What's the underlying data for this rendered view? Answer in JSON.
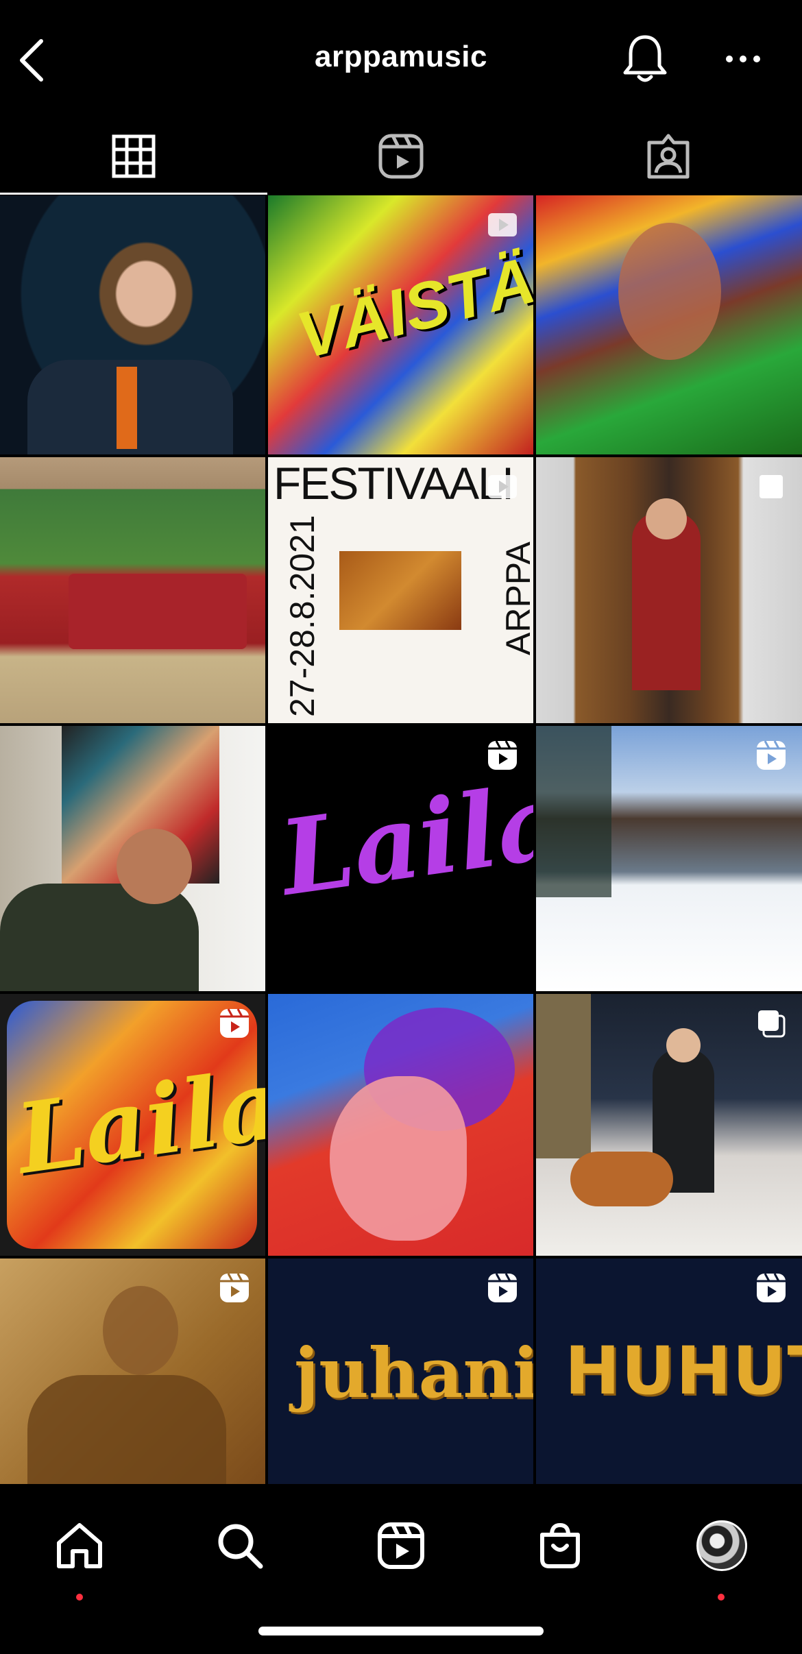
{
  "header": {
    "username": "arppamusic"
  },
  "tabs": [
    {
      "name": "posts",
      "icon": "grid-icon",
      "active": true
    },
    {
      "name": "reels",
      "icon": "reels-icon",
      "active": false
    },
    {
      "name": "tagged",
      "icon": "tagged-icon",
      "active": false
    }
  ],
  "grid": {
    "posts": [
      {
        "row": 1,
        "col": 1,
        "type": "photo",
        "badge": ""
      },
      {
        "row": 1,
        "col": 2,
        "type": "reel",
        "badge": "video-icon",
        "text": "VÄISTÄ"
      },
      {
        "row": 1,
        "col": 3,
        "type": "photo",
        "badge": ""
      },
      {
        "row": 2,
        "col": 1,
        "type": "photo",
        "badge": ""
      },
      {
        "row": 2,
        "col": 2,
        "type": "reel",
        "badge": "video-icon",
        "text_top": "FESTIVAALI",
        "text_left": "27-28.8.2021",
        "text_right": "ARPPA"
      },
      {
        "row": 2,
        "col": 3,
        "type": "carousel",
        "badge": "carousel-icon"
      },
      {
        "row": 3,
        "col": 1,
        "type": "photo",
        "badge": ""
      },
      {
        "row": 3,
        "col": 2,
        "type": "reel",
        "badge": "reels-icon",
        "text": "Laila"
      },
      {
        "row": 3,
        "col": 3,
        "type": "reel",
        "badge": "reels-icon"
      },
      {
        "row": 4,
        "col": 1,
        "type": "reel",
        "badge": "reels-icon",
        "text": "Laila"
      },
      {
        "row": 4,
        "col": 2,
        "type": "photo",
        "badge": ""
      },
      {
        "row": 4,
        "col": 3,
        "type": "carousel",
        "badge": "carousel-icon"
      },
      {
        "row": 5,
        "col": 1,
        "type": "reel",
        "badge": "reels-icon"
      },
      {
        "row": 5,
        "col": 2,
        "type": "reel",
        "badge": "reels-icon",
        "text": "juhani"
      },
      {
        "row": 5,
        "col": 3,
        "type": "reel",
        "badge": "reels-icon",
        "text": "HUHUT"
      }
    ]
  },
  "nav": [
    {
      "name": "home",
      "icon": "home-icon",
      "notification_dot": true
    },
    {
      "name": "search",
      "icon": "search-icon",
      "notification_dot": false
    },
    {
      "name": "reels",
      "icon": "reels-icon",
      "notification_dot": false
    },
    {
      "name": "shop",
      "icon": "shop-icon",
      "notification_dot": false
    },
    {
      "name": "profile",
      "icon": "avatar",
      "notification_dot": true
    }
  ],
  "colors": {
    "background": "#000000",
    "notification": "#ff3040",
    "laila_purple": "#b53ee6",
    "juhani_gold": "#e3a92c"
  }
}
